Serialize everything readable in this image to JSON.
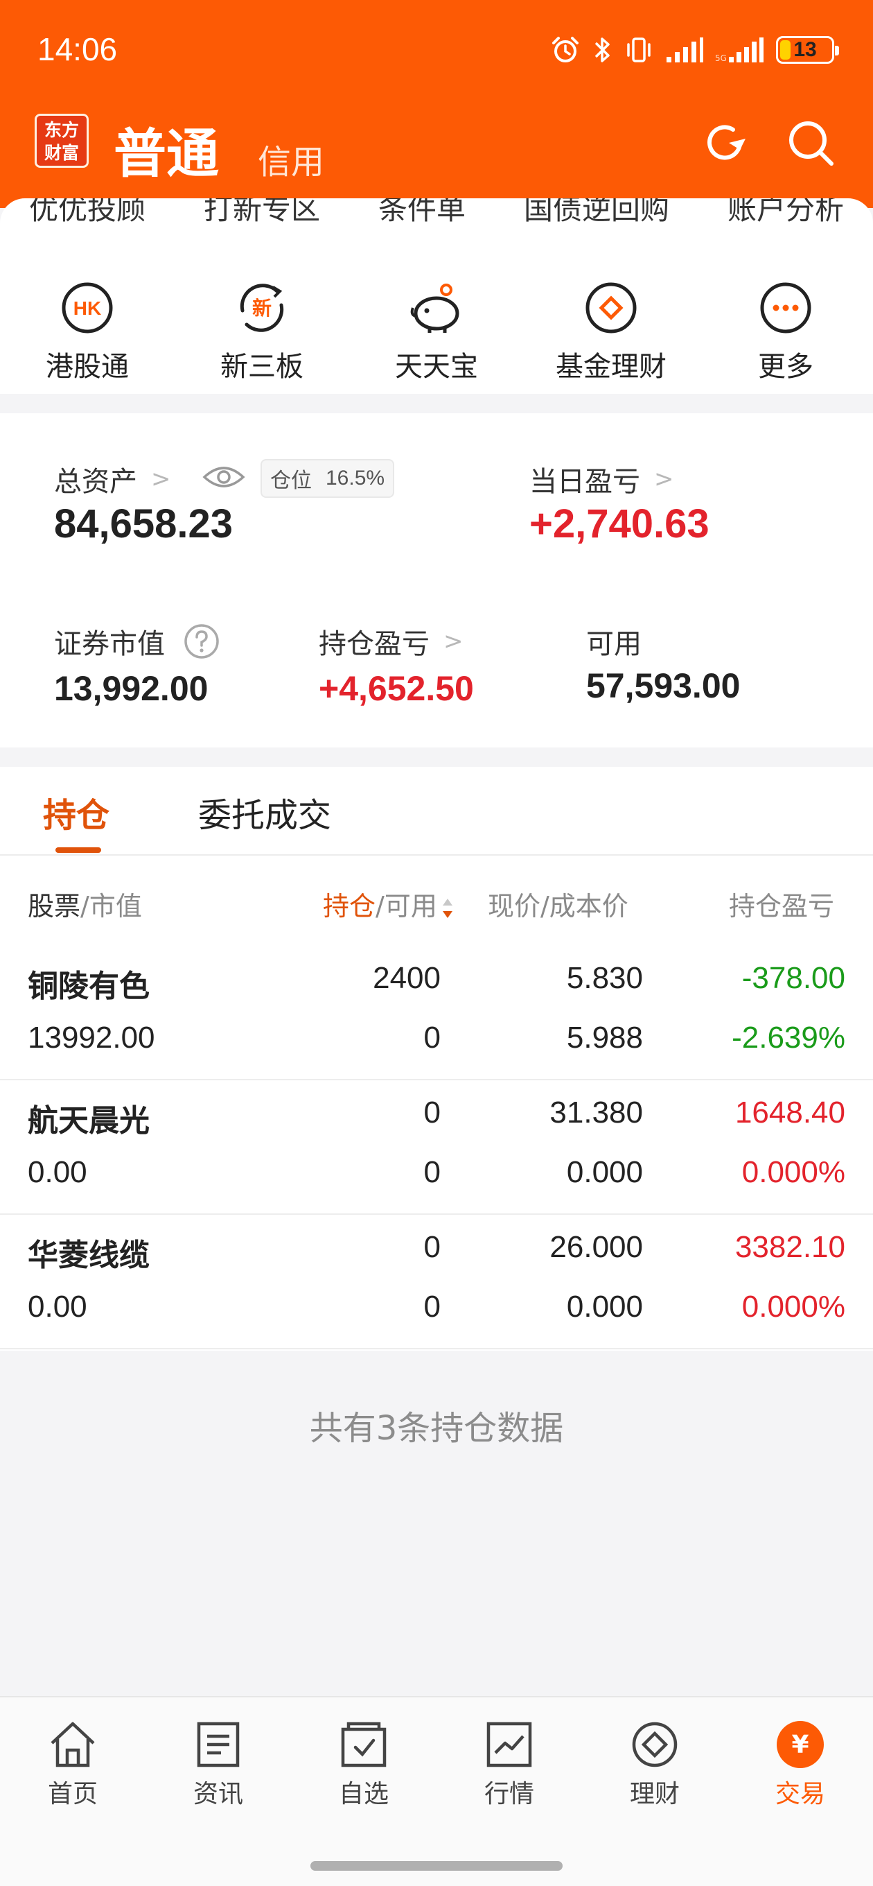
{
  "status_bar": {
    "time": "14:06",
    "battery": "13",
    "battery_level": 0.13
  },
  "header": {
    "logo_line1": "东方",
    "logo_line2": "财富",
    "mode_main": "普通",
    "mode_sub": "信用"
  },
  "peek_row": [
    "优优投顾",
    "打新专区",
    "条件单",
    "国债逆回购",
    "账户分析"
  ],
  "shortcuts": [
    {
      "label": "港股通",
      "icon": "hk-icon",
      "glyph": "HK"
    },
    {
      "label": "新三板",
      "icon": "new-board-icon",
      "glyph": "新"
    },
    {
      "label": "天天宝",
      "icon": "piggy-bank-icon"
    },
    {
      "label": "基金理财",
      "icon": "fund-diamond-icon"
    },
    {
      "label": "更多",
      "icon": "more-icon"
    }
  ],
  "assets": {
    "total_label": "总资产",
    "total_value": "84,658.23",
    "position_label": "仓位",
    "position_value": "16.5%",
    "daily_pl_label": "当日盈亏",
    "daily_pl_value": "+2,740.63",
    "market_value_label": "证券市值",
    "market_value": "13,992.00",
    "holding_pl_label": "持仓盈亏",
    "holding_pl_value": "+4,652.50",
    "available_label": "可用",
    "available_value": "57,593.00"
  },
  "holdings": {
    "tabs": [
      "持仓",
      "委托成交"
    ],
    "columns": {
      "stock": "股票",
      "stock_sub": "/市值",
      "hold": "持仓",
      "hold_sub": "/可用",
      "price": "现价/成本价",
      "pl": "持仓盈亏"
    },
    "rows": [
      {
        "name": "铜陵有色",
        "market_value": "13992.00",
        "hold": "2400",
        "available": "0",
        "price": "5.830",
        "cost": "5.988",
        "pl": "-378.00",
        "pl_pct": "-2.639%",
        "pl_color": "#1a9b1a"
      },
      {
        "name": "航天晨光",
        "market_value": "0.00",
        "hold": "0",
        "available": "0",
        "price": "31.380",
        "cost": "0.000",
        "pl": "1648.40",
        "pl_pct": "0.000%",
        "pl_color": "#e3232c"
      },
      {
        "name": "华菱线缆",
        "market_value": "0.00",
        "hold": "0",
        "available": "0",
        "price": "26.000",
        "cost": "0.000",
        "pl": "3382.10",
        "pl_pct": "0.000%",
        "pl_color": "#e3232c"
      }
    ],
    "summary": "共有3条持仓数据"
  },
  "nav": [
    {
      "label": "首页",
      "icon": "home-icon"
    },
    {
      "label": "资讯",
      "icon": "news-icon"
    },
    {
      "label": "自选",
      "icon": "watchlist-icon"
    },
    {
      "label": "行情",
      "icon": "market-chart-icon"
    },
    {
      "label": "理财",
      "icon": "wealth-icon"
    },
    {
      "label": "交易",
      "icon": "trade-icon",
      "glyph": "¥",
      "active": true
    }
  ],
  "colors": {
    "brand": "#fd5a05",
    "accent": "#e0530a",
    "up": "#e3232c",
    "down": "#1a9b1a"
  }
}
